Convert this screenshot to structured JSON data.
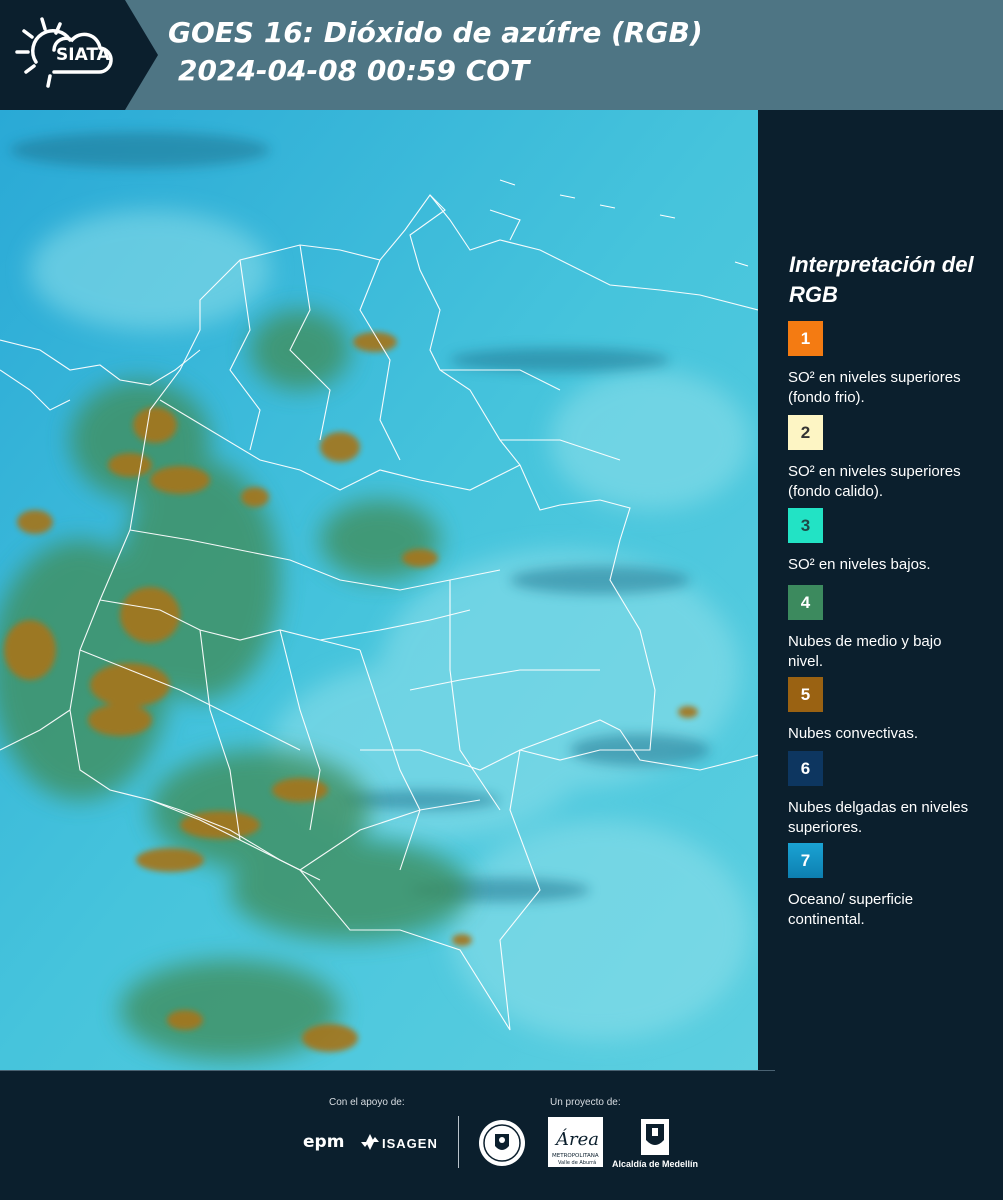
{
  "header": {
    "logo_text": "SIATA",
    "title_line1": "GOES 16: Dióxido de azúfre (RGB)",
    "title_line2": "2024-04-08 00:59 COT"
  },
  "legend": {
    "title": "Interpretación del RGB",
    "items": [
      {
        "number": "1",
        "color": "#f47b12",
        "text_color": "#ffffff",
        "label": "SO² en niveles superiores (fondo frio)."
      },
      {
        "number": "2",
        "color": "#fdf5c4",
        "text_color": "#333333",
        "label": "SO² en niveles superiores (fondo calido)."
      },
      {
        "number": "3",
        "color": "#22e3c5",
        "text_color": "#1f4a46",
        "label": "SO² en niveles bajos."
      },
      {
        "number": "4",
        "color": "#3c8a5e",
        "text_color": "#ffffff",
        "label": "Nubes de medio y bajo nivel."
      },
      {
        "number": "5",
        "color": "#9a6212",
        "text_color": "#ffffff",
        "label": "Nubes convectivas."
      },
      {
        "number": "6",
        "color": "#0d3660",
        "text_color": "#ffffff",
        "label": "Nubes delgadas en niveles superiores."
      },
      {
        "number": "7",
        "color": "#1f97c4",
        "text_color": "#ffffff",
        "label": "Oceano/ superficie continental."
      }
    ]
  },
  "footer": {
    "support_label": "Con el apoyo de:",
    "project_label": "Un proyecto de:",
    "sponsor1": "epm",
    "sponsor2": "ISAGEN",
    "area_logo_text": "Área",
    "area_subtext": "METROPOLITANA",
    "area_subtext2": "Valle de Aburrá",
    "alcaldia": "Alcaldía de Medellín"
  }
}
